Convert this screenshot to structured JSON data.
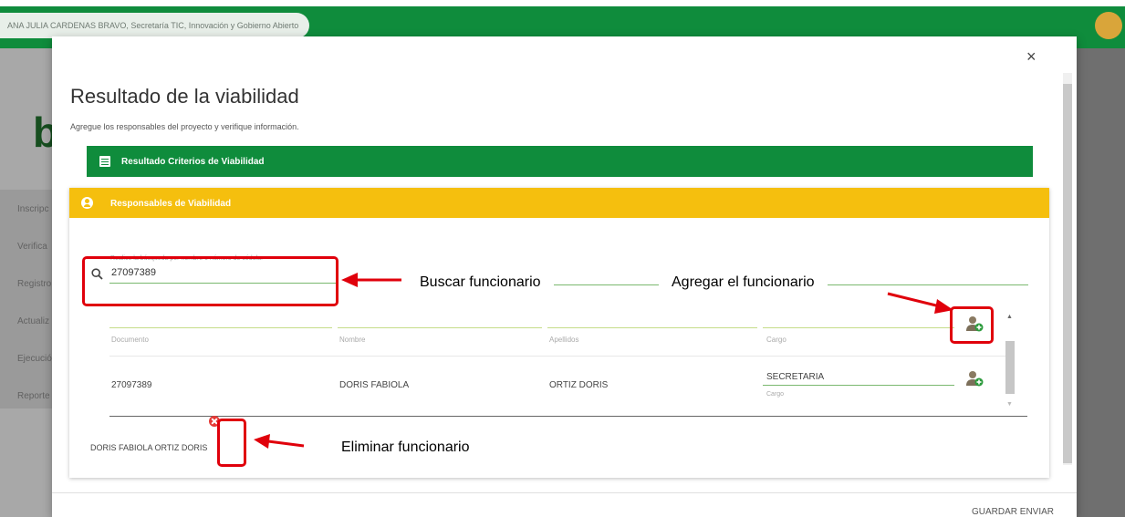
{
  "app": {
    "user_name": "ANA JULIA CARDENAS BRAVO, Secretaría TIC, Innovación y Gobierno Abierto",
    "logo_letter": "b",
    "side_menu": [
      "Inscripc",
      "Verifica",
      "Registro",
      "Actualiz",
      "Ejecució",
      "Reporte"
    ]
  },
  "modal": {
    "close_label": "×",
    "title": "Resultado de la viabilidad",
    "subtitle": "Agregue los responsables del proyecto y verifique información.",
    "criteria_section_label": "Resultado Criterios de Viabilidad",
    "responsables": {
      "header_label": "Responsables de Viabilidad",
      "search": {
        "hint": "Realice la búsqueda por nombre o número de cédula.",
        "value": "27097389"
      },
      "columns": [
        "Documento",
        "Nombre",
        "Apellidos",
        "Cargo"
      ],
      "rows": [
        {
          "documento": "27097389",
          "nombre": "DORIS FABIOLA",
          "apellidos": "ORTIZ DORIS",
          "cargo_value": "SECRETARIA",
          "cargo_label": "Cargo"
        }
      ],
      "selected": [
        "DORIS FABIOLA ORTIZ DORIS"
      ]
    },
    "footer_button": "GUARDAR ENVIAR"
  },
  "annotations": {
    "buscar": "Buscar funcionario",
    "agregar": "Agregar el funcionario",
    "eliminar": "Eliminar funcionario",
    "color": "#e0000b"
  },
  "colors": {
    "green": "#0f8c3c",
    "yellow": "#f5bf0e"
  },
  "icons": [
    "search-icon",
    "list-icon",
    "user-circle-icon",
    "user-add-icon",
    "remove-icon",
    "close-icon"
  ]
}
